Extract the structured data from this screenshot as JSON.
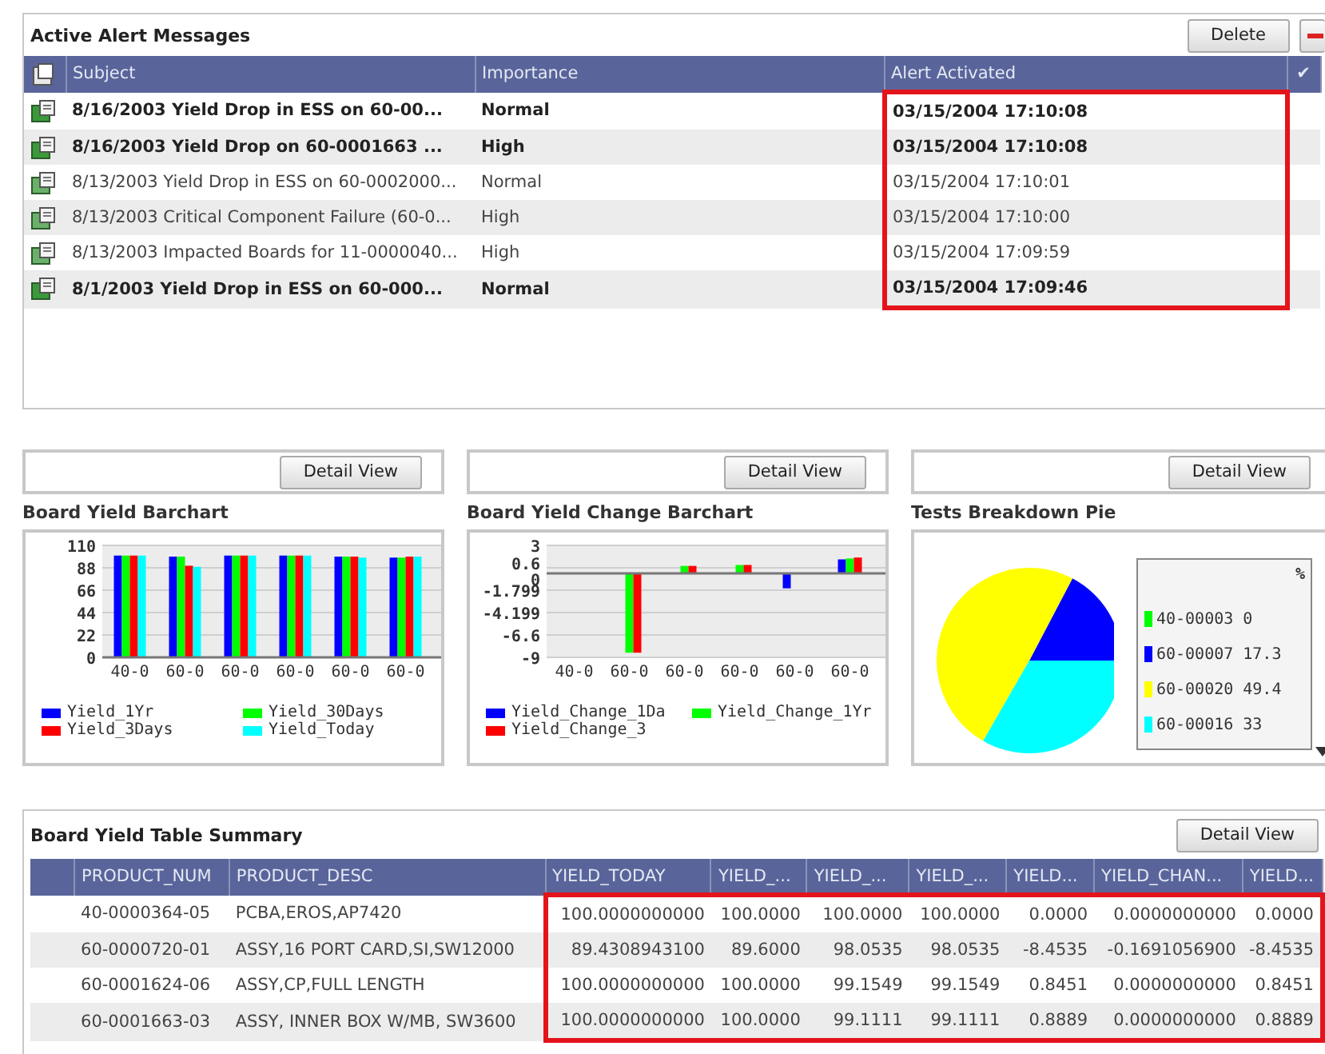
{
  "alerts": {
    "title": "Active Alert Messages",
    "buttons": [
      "Delete"
    ],
    "columns": [
      {
        "label": "Subject",
        "highlighted": false
      },
      {
        "label": "Importance",
        "highlighted": false
      },
      {
        "label": "Alert Activated",
        "highlighted": true
      },
      {
        "label": "✔",
        "highlighted": false
      }
    ],
    "rows": [
      {
        "subject": "8/16/2003 Yield Drop in ESS on 60-00...",
        "importance": "Normal",
        "activated": "03/15/2004 17:10:08",
        "unread": true
      },
      {
        "subject": "8/16/2003 Yield Drop on 60-0001663 ...",
        "importance": "High",
        "activated": "03/15/2004 17:10:08",
        "unread": true
      },
      {
        "subject": "8/13/2003 Yield Drop in ESS on 60-0002000...",
        "importance": "Normal",
        "activated": "03/15/2004 17:10:01",
        "unread": false
      },
      {
        "subject": "8/13/2003 Critical Component Failure (60-0...",
        "importance": "High",
        "activated": "03/15/2004 17:10:00",
        "unread": false
      },
      {
        "subject": "8/13/2003 Impacted Boards for 11-0000040...",
        "importance": "High",
        "activated": "03/15/2004 17:09:59",
        "unread": false
      },
      {
        "subject": "8/1/2003 Yield Drop in ESS on 60-000...",
        "importance": "Normal",
        "activated": "03/15/2004 17:09:46",
        "unread": true
      }
    ]
  },
  "panels": [
    {
      "button": "Detail View",
      "title": "Board Yield Barchart",
      "chart_data": {
        "type": "bar",
        "grid": true,
        "categories": [
          "40-0",
          "60-0",
          "60-0",
          "60-0",
          "60-0",
          "60-0"
        ],
        "ylim": [
          0,
          110
        ],
        "yticks": [
          0,
          22,
          44,
          66,
          88,
          110
        ],
        "series": [
          {
            "name": "Yield_1Yr",
            "color": "#0000ff",
            "values": [
              100,
              99,
              100,
              100,
              99,
              98
            ]
          },
          {
            "name": "Yield_30Days",
            "color": "#00ff00",
            "values": [
              100,
              99,
              100,
              100,
              99,
              98
            ]
          },
          {
            "name": "Yield_3Days",
            "color": "#ff0000",
            "values": [
              100,
              90,
              100,
              100,
              99,
              99
            ]
          },
          {
            "name": "Yield_Today",
            "color": "#00ffff",
            "values": [
              100,
              89,
              100,
              100,
              98,
              99
            ]
          }
        ]
      }
    },
    {
      "button": "Detail View",
      "title": "Board Yield Change Barchart",
      "chart_data": {
        "type": "bar",
        "grid": true,
        "categories": [
          "40-0",
          "60-0",
          "60-0",
          "60-0",
          "60-0",
          "60-0"
        ],
        "ylim": [
          -9,
          3
        ],
        "yticks": [
          {
            "value": 3,
            "label": "3"
          },
          {
            "value": 0.6,
            "label": "0.6"
          },
          {
            "value": 0,
            "label": "0"
          },
          {
            "value": -1.799,
            "label": "-1.799"
          },
          {
            "value": -4.199,
            "label": "-4.199"
          },
          {
            "value": -6.6,
            "label": "-6.6"
          },
          {
            "value": -9,
            "label": "-9"
          }
        ],
        "series": [
          {
            "name": "Yield_Change_1Da",
            "color": "#0000ff",
            "values": [
              0,
              0,
              0,
              0,
              -1.6,
              1.5
            ]
          },
          {
            "name": "Yield_Change_1Yr",
            "color": "#00ff00",
            "values": [
              0,
              -8.5,
              0.8,
              0.9,
              0,
              1.6
            ]
          },
          {
            "name": "Yield_Change_3",
            "color": "#ff0000",
            "values": [
              0,
              -8.5,
              0.8,
              0.9,
              0,
              1.7
            ]
          }
        ]
      }
    },
    {
      "button": "Detail View",
      "title": "Tests Breakdown Pie",
      "chart_data": {
        "type": "pie",
        "categories": [
          "40-00003",
          "60-00007",
          "60-00020",
          "60-00016"
        ],
        "values": [
          0,
          17.3,
          49.4,
          33.3
        ],
        "colors": [
          "#00ff00",
          "#0000ff",
          "#ffff00",
          "#00ffff"
        ]
      },
      "legend": {
        "heading": "%",
        "items": [
          {
            "value": "0"
          },
          {
            "value": "17.3"
          },
          {
            "value": "49.4"
          },
          {
            "value": "33"
          }
        ]
      }
    }
  ],
  "summary": {
    "title": "Board Yield Table Summary",
    "button": "Detail View",
    "columns": [
      {
        "label": "PRODUCT_NUM",
        "highlighted": false
      },
      {
        "label": "PRODUCT_DESC",
        "highlighted": false
      },
      {
        "label": "YIELD_TODAY",
        "highlighted": true
      },
      {
        "label": "YIELD_...",
        "highlighted": true
      },
      {
        "label": "YIELD_...",
        "highlighted": true
      },
      {
        "label": "YIELD_...",
        "highlighted": true
      },
      {
        "label": "YIELD...",
        "highlighted": true
      },
      {
        "label": "YIELD_CHAN...",
        "highlighted": true
      },
      {
        "label": "YIELD...",
        "highlighted": true
      }
    ],
    "rows": [
      [
        "40-0000364-05",
        "PCBA,EROS,AP7420",
        "100.0000000000",
        "100.0000",
        "100.0000",
        "100.0000",
        "0.0000",
        "0.0000000000",
        "0.0000"
      ],
      [
        "60-0000720-01",
        "ASSY,16 PORT CARD,SI,SW12000",
        "89.4308943100",
        "89.6000",
        "98.0535",
        "98.0535",
        "-8.4535",
        "-0.1691056900",
        "-8.4535"
      ],
      [
        "60-0001624-06",
        "ASSY,CP,FULL LENGTH",
        "100.0000000000",
        "100.0000",
        "99.1549",
        "99.1549",
        "0.8451",
        "0.0000000000",
        "0.8451"
      ],
      [
        "60-0001663-03",
        "ASSY, INNER BOX W/MB, SW3600",
        "100.0000000000",
        "100.0000",
        "99.1111",
        "99.1111",
        "0.8889",
        "0.0000000000",
        "0.8889"
      ]
    ]
  }
}
